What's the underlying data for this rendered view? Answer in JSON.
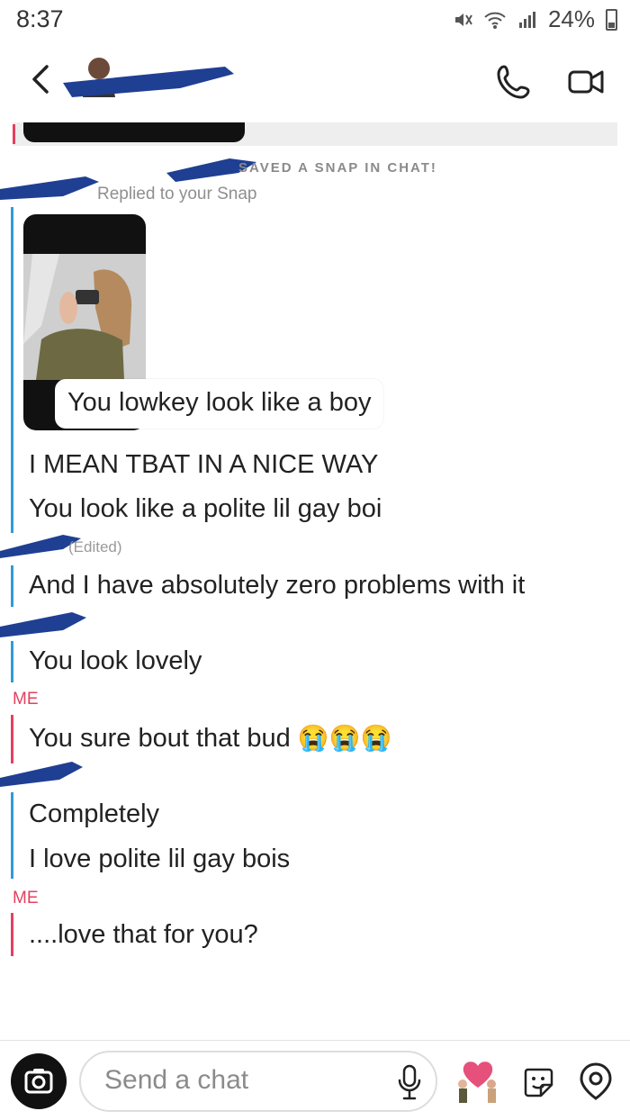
{
  "status_bar": {
    "time": "8:37",
    "battery": "24%"
  },
  "header": {
    "back_icon": "chevron-left-icon",
    "call_icon": "phone-icon",
    "video_icon": "video-camera-icon"
  },
  "notes": {
    "saved": "SAVED A SNAP IN CHAT!",
    "replied": "Replied to your Snap"
  },
  "snap_reply": {
    "caption": "You lowkey look like a boy"
  },
  "messages": [
    "I MEAN TBAT IN A NICE WAY",
    "You look like a polite lil gay boi",
    "(Edited)",
    "And I have absolutely zero problems with it",
    "You look lovely",
    "ME",
    "You sure bout that bud",
    "Completely",
    "I love polite lil gay bois",
    "ME",
    "....love that for you?"
  ],
  "emoji": "😭😭😭",
  "composer": {
    "placeholder": "Send a chat"
  },
  "colors": {
    "friend_bar": "#2f9bd8",
    "me_bar": "#e4405f",
    "redaction": "#1f3f93"
  }
}
